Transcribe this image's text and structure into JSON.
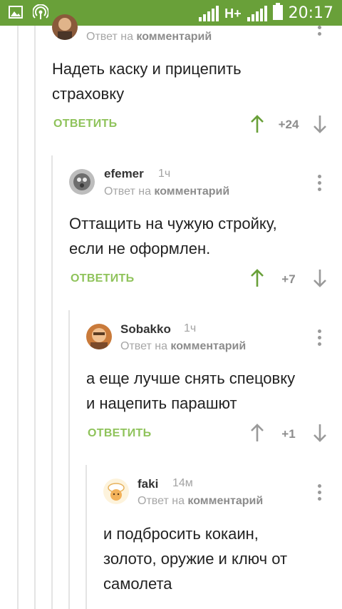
{
  "statusbar": {
    "network": "H+",
    "time": "20:17",
    "icons": [
      "gallery-icon",
      "hotspot-icon",
      "signal-icon",
      "signal-icon",
      "battery-icon"
    ]
  },
  "colors": {
    "statusbar": "#69a039",
    "accent": "#8fc35b",
    "upvote_active": "#69a039",
    "vote_neutral": "#9a9a9a"
  },
  "comments": [
    {
      "reply_to_prefix": "Ответ на",
      "reply_to_target": "комментарий",
      "text_lines": [
        "Надеть каску и прицепить",
        "страховку"
      ],
      "reply_label": "ОТВЕТИТЬ",
      "rating": "+24",
      "upvoted": true
    },
    {
      "author": "efemer",
      "time": "1ч",
      "reply_to_prefix": "Ответ на",
      "reply_to_target": "комментарий",
      "text_lines": [
        "Оттащить на чужую стройку,",
        "если не оформлен."
      ],
      "reply_label": "ОТВЕТИТЬ",
      "rating": "+7",
      "upvoted": true
    },
    {
      "author": "Sobakko",
      "time": "1ч",
      "reply_to_prefix": "Ответ на",
      "reply_to_target": "комментарий",
      "text_lines": [
        "а еще лучше снять спецовку",
        "и нацепить парашют"
      ],
      "reply_label": "ОТВЕТИТЬ",
      "rating": "+1",
      "upvoted": false
    },
    {
      "author": "faki",
      "time": "14м",
      "reply_to_prefix": "Ответ на",
      "reply_to_target": "комментарий",
      "text_lines": [
        "и подбросить кокаин,",
        "золото, оружие и ключ от",
        "самолета"
      ]
    }
  ]
}
